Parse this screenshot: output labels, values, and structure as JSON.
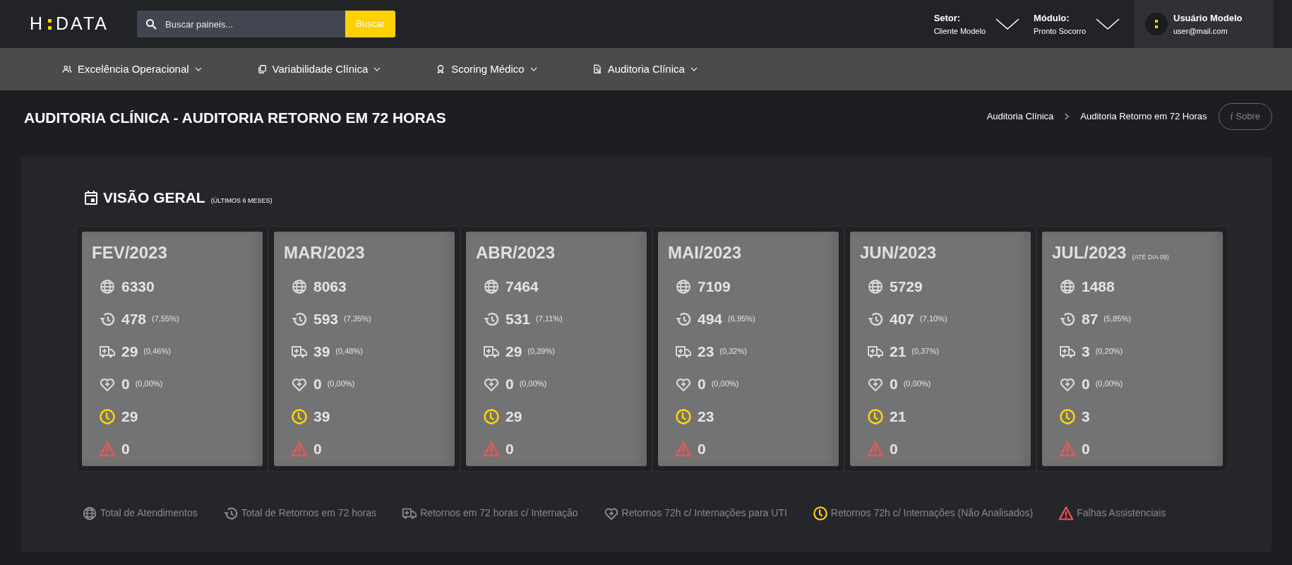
{
  "header": {
    "logo_left": "H",
    "logo_right": "DATA",
    "search": {
      "placeholder": "Buscar paineis...",
      "button": "Buscar"
    },
    "selectors": [
      {
        "label": "Setor:",
        "value": "Cliente Modelo"
      },
      {
        "label": "Módulo:",
        "value": "Pronto Socorro"
      }
    ],
    "user": {
      "name": "Usuário Modelo",
      "email": "user@mail.com"
    }
  },
  "menu": [
    {
      "kind": "people",
      "label": "Excelência Operacional"
    },
    {
      "kind": "copy",
      "label": "Variabilidade Clínica"
    },
    {
      "kind": "award",
      "label": "Scoring Médico"
    },
    {
      "kind": "report",
      "label": "Auditoria Clínica"
    }
  ],
  "page_title": "AUDITORIA CLÍNICA - AUDITORIA RETORNO EM 72 HORAS",
  "breadcrumb": [
    "Auditoria Clínica",
    "Auditoria Retorno em 72 Horas"
  ],
  "about_button": {
    "icon": "i",
    "label": "Sobre"
  },
  "section": {
    "title": "VISÃO GERAL",
    "subtitle": "(ÚLTIMOS 6 MESES)"
  },
  "months": [
    {
      "label": "FEV/2023",
      "metrics": [
        {
          "kind": "globe",
          "value": "6330"
        },
        {
          "kind": "history",
          "value": "478",
          "pct": "(7,55%)"
        },
        {
          "kind": "ambulance",
          "value": "29",
          "pct": "(0,46%)"
        },
        {
          "kind": "heart",
          "value": "0",
          "pct": "(0,00%)"
        },
        {
          "kind": "clock",
          "value": "29"
        },
        {
          "kind": "warning",
          "value": "0"
        }
      ]
    },
    {
      "label": "MAR/2023",
      "metrics": [
        {
          "kind": "globe",
          "value": "8063"
        },
        {
          "kind": "history",
          "value": "593",
          "pct": "(7,35%)"
        },
        {
          "kind": "ambulance",
          "value": "39",
          "pct": "(0,48%)"
        },
        {
          "kind": "heart",
          "value": "0",
          "pct": "(0,00%)"
        },
        {
          "kind": "clock",
          "value": "39"
        },
        {
          "kind": "warning",
          "value": "0"
        }
      ]
    },
    {
      "label": "ABR/2023",
      "metrics": [
        {
          "kind": "globe",
          "value": "7464"
        },
        {
          "kind": "history",
          "value": "531",
          "pct": "(7,11%)"
        },
        {
          "kind": "ambulance",
          "value": "29",
          "pct": "(0,39%)"
        },
        {
          "kind": "heart",
          "value": "0",
          "pct": "(0,00%)"
        },
        {
          "kind": "clock",
          "value": "29"
        },
        {
          "kind": "warning",
          "value": "0"
        }
      ]
    },
    {
      "label": "MAI/2023",
      "metrics": [
        {
          "kind": "globe",
          "value": "7109"
        },
        {
          "kind": "history",
          "value": "494",
          "pct": "(6,95%)"
        },
        {
          "kind": "ambulance",
          "value": "23",
          "pct": "(0,32%)"
        },
        {
          "kind": "heart",
          "value": "0",
          "pct": "(0,00%)"
        },
        {
          "kind": "clock",
          "value": "23"
        },
        {
          "kind": "warning",
          "value": "0"
        }
      ]
    },
    {
      "label": "JUN/2023",
      "metrics": [
        {
          "kind": "globe",
          "value": "5729"
        },
        {
          "kind": "history",
          "value": "407",
          "pct": "(7,10%)"
        },
        {
          "kind": "ambulance",
          "value": "21",
          "pct": "(0,37%)"
        },
        {
          "kind": "heart",
          "value": "0",
          "pct": "(0,00%)"
        },
        {
          "kind": "clock",
          "value": "21"
        },
        {
          "kind": "warning",
          "value": "0"
        }
      ]
    },
    {
      "label": "JUL/2023",
      "note": "(ATÉ DIA 09)",
      "metrics": [
        {
          "kind": "globe",
          "value": "1488"
        },
        {
          "kind": "history",
          "value": "87",
          "pct": "(5,85%)"
        },
        {
          "kind": "ambulance",
          "value": "3",
          "pct": "(0,20%)"
        },
        {
          "kind": "heart",
          "value": "0",
          "pct": "(0,00%)"
        },
        {
          "kind": "clock",
          "value": "3"
        },
        {
          "kind": "warning",
          "value": "0"
        }
      ]
    }
  ],
  "legend": [
    {
      "kind": "globe",
      "label": "Total de Atendimentos"
    },
    {
      "kind": "history",
      "label": "Total de Retornos em 72 horas"
    },
    {
      "kind": "ambulance",
      "label": "Retornos em 72 horas c/ Internação"
    },
    {
      "kind": "heart",
      "label": "Retornos 72h c/ Internações para UTI"
    },
    {
      "kind": "clock",
      "label": "Retornos 72h c/ Internações (Não Analisados)"
    },
    {
      "kind": "warning",
      "label": "Falhas Assistenciais"
    }
  ]
}
